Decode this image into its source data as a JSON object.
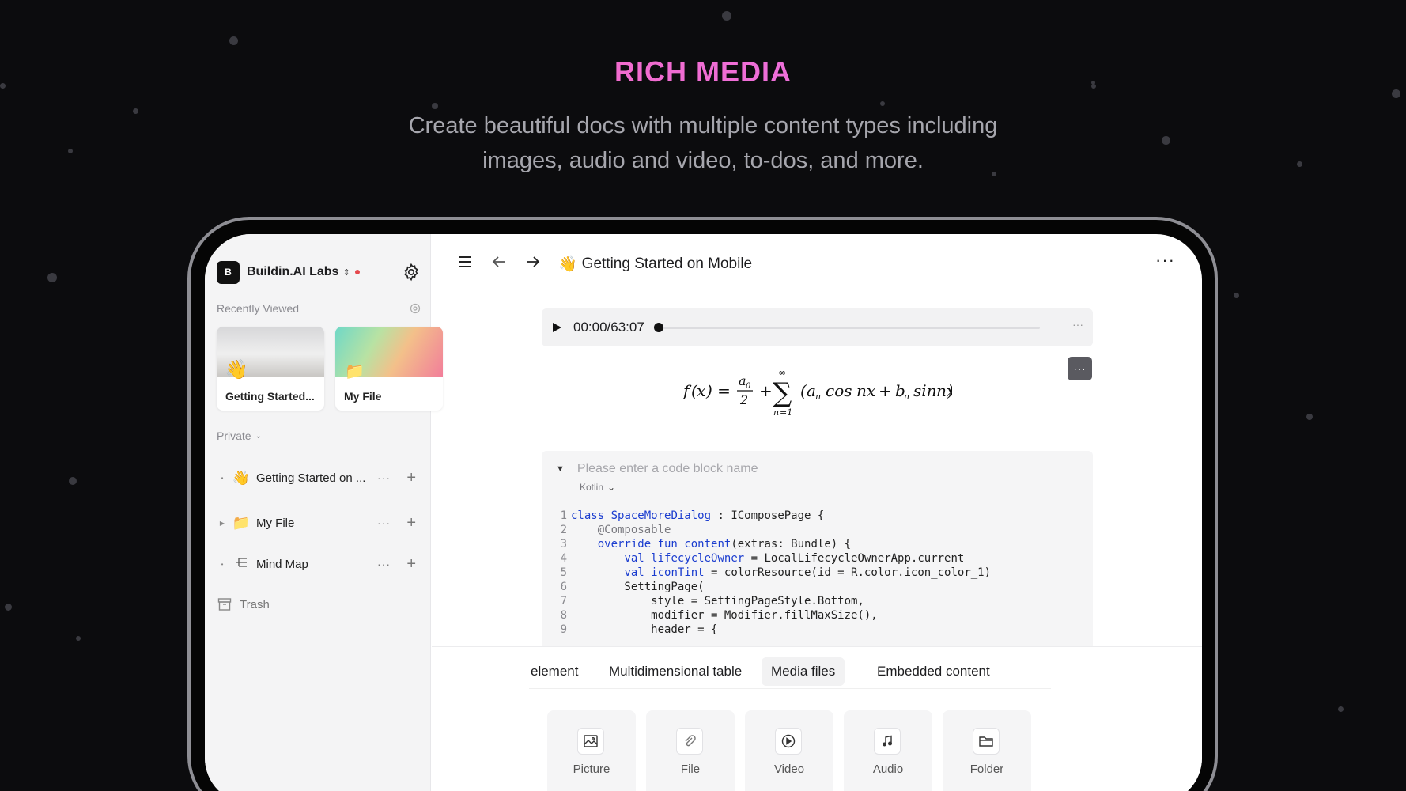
{
  "hero": {
    "title": "RICH MEDIA",
    "subtitle_line1": "Create beautiful docs with multiple content types including",
    "subtitle_line2": "images, audio and video, to-dos, and more."
  },
  "sidebar": {
    "workspace": {
      "logo_letter": "B",
      "name": "Buildin.AI Labs",
      "switch_icon": "chevron-updown-icon",
      "status_color": "#e5484d"
    },
    "recently_viewed_label": "Recently Viewed",
    "recent_cards": [
      {
        "label": "Getting Started...",
        "emoji": "👋"
      },
      {
        "label": "My File",
        "emoji": "📁"
      }
    ],
    "private_label": "Private",
    "tree": [
      {
        "label": "Getting Started on ...",
        "emoji": "👋"
      },
      {
        "label": "My File",
        "emoji": "📁"
      },
      {
        "label": "Mind Map",
        "icon": "mind-map-icon"
      }
    ],
    "trash_label": "Trash"
  },
  "page": {
    "title_emoji": "👋",
    "title": "Getting Started on Mobile"
  },
  "audio": {
    "time": "00:00/63:07",
    "progress": 0
  },
  "code_block": {
    "name_placeholder": "Please enter a code block name",
    "language": "Kotlin",
    "line_numbers": [
      "1",
      "2",
      "3",
      "4",
      "5",
      "6",
      "7",
      "8",
      "9"
    ]
  },
  "insert_panel": {
    "tabs": [
      "element",
      "Multidimensional table",
      "Media files",
      "Embedded content"
    ],
    "active_tab": "Media files",
    "tiles": [
      {
        "label": "Picture",
        "icon": "picture-icon"
      },
      {
        "label": "File",
        "icon": "paperclip-icon"
      },
      {
        "label": "Video",
        "icon": "video-icon"
      },
      {
        "label": "Audio",
        "icon": "audio-icon"
      },
      {
        "label": "Folder",
        "icon": "folder-icon"
      }
    ]
  },
  "colors": {
    "accent_gradient_start": "#ff5fa8",
    "accent_gradient_end": "#e07bff",
    "background": "#0c0c0e"
  }
}
